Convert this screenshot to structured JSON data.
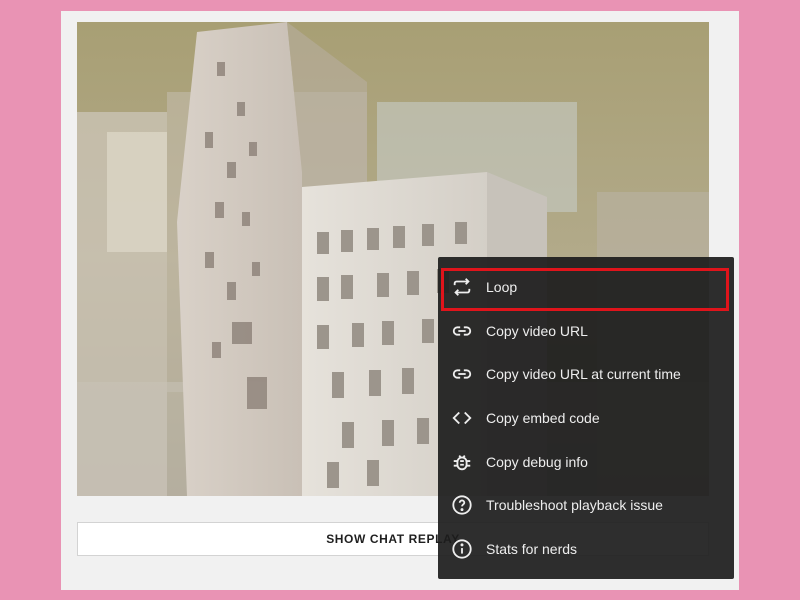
{
  "colors": {
    "background": "#e993b4",
    "menu_bg": "#1c1c1c",
    "highlight": "#e0141b"
  },
  "chat_replay": {
    "label": "SHOW CHAT REPLAY"
  },
  "context_menu": {
    "items": [
      {
        "label": "Loop",
        "icon": "loop-icon"
      },
      {
        "label": "Copy video URL",
        "icon": "link-icon"
      },
      {
        "label": "Copy video URL at current time",
        "icon": "link-icon"
      },
      {
        "label": "Copy embed code",
        "icon": "code-icon"
      },
      {
        "label": "Copy debug info",
        "icon": "bug-icon"
      },
      {
        "label": "Troubleshoot playback issue",
        "icon": "help-circle-icon"
      },
      {
        "label": "Stats for nerds",
        "icon": "info-circle-icon"
      }
    ],
    "highlighted_item": "Loop"
  }
}
